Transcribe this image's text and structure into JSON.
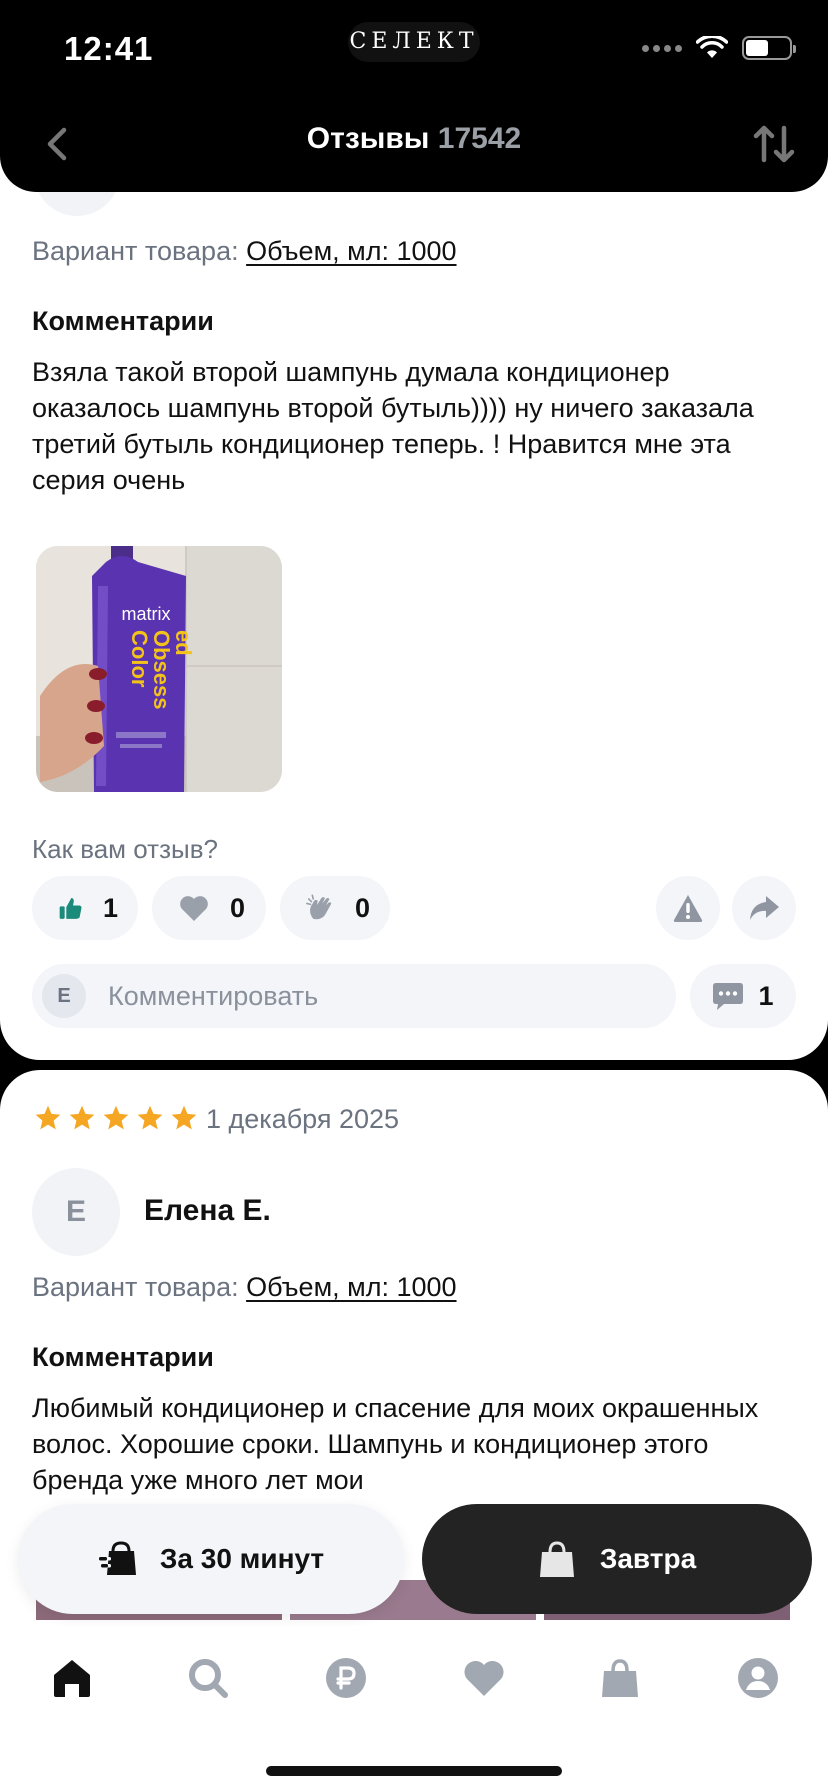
{
  "status_bar": {
    "time": "12:41",
    "brand": "СЕЛЕКТ"
  },
  "header": {
    "title": "Отзывы",
    "count": "17542",
    "back_icon": "chevron-left-icon",
    "sort_icon": "sort-arrows-icon"
  },
  "review1": {
    "variant_label": "Вариант товара:",
    "variant_value": "Объем, мл: 1000",
    "comments_title": "Комментарии",
    "text": "Взяла такой второй шампунь думала кондиционер оказалось шампунь второй бутыль)))) ну ничего заказала третий бутыль кондиционер теперь. ! Нравится мне эта серия очень",
    "photo": {
      "brand": "matrix",
      "product_line1": "Color",
      "product_line2": "Obsess",
      "product_line3": "ed"
    },
    "feedback_question": "Как вам отзыв?",
    "reactions": [
      {
        "icon": "thumbs-up-icon",
        "count": "1",
        "color": "#1a8a7a"
      },
      {
        "icon": "heart-icon",
        "count": "0",
        "color": "#9aa0aa"
      },
      {
        "icon": "clap-icon",
        "count": "0",
        "color": "#9aa0aa"
      }
    ],
    "report_icon": "warning-icon",
    "share_icon": "share-icon",
    "comment_avatar": "Е",
    "comment_placeholder": "Комментировать",
    "comments_count": "1"
  },
  "review2": {
    "rating": 5,
    "date": "1 декабря 2025",
    "avatar_letter": "Е",
    "author": "Елена Е.",
    "variant_label": "Вариант товара:",
    "variant_value": "Объем, мл: 1000",
    "comments_title": "Комментарии",
    "text": "Любимый кондиционер и спасение для моих окрашенных волос. Хорошие сроки. Шампунь и кондиционер этого бренда уже много лет мои"
  },
  "delivery": {
    "fast_label": "За 30 минут",
    "tomorrow_label": "Завтра"
  },
  "colors": {
    "star": "#f5a623",
    "accent_green": "#1a8a7a",
    "dark_button": "#232323"
  },
  "nav": [
    "home-icon",
    "search-icon",
    "ruble-icon",
    "heart-icon",
    "bag-icon",
    "profile-icon"
  ]
}
